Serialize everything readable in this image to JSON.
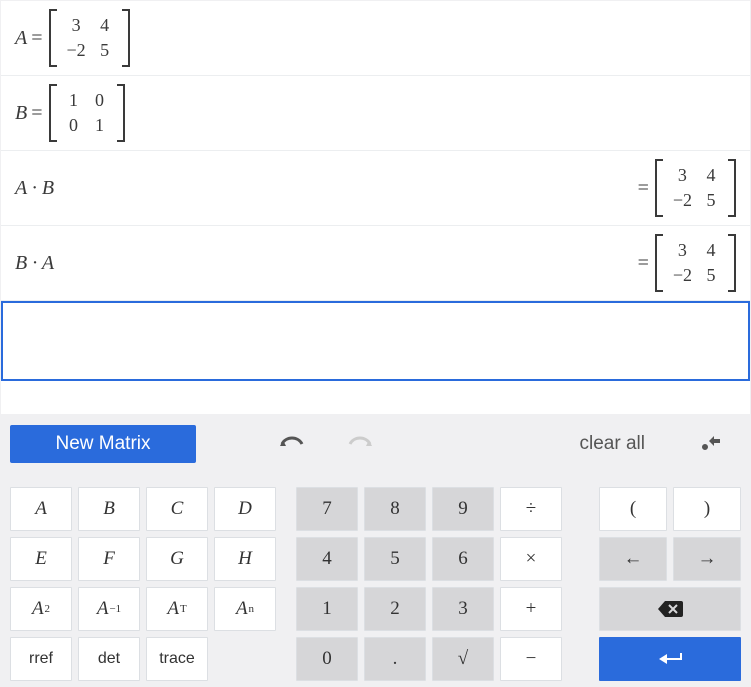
{
  "rows": {
    "r1_var": "A",
    "r1_eq": "=",
    "r2_var": "B",
    "r2_eq": "=",
    "r3_expr": "A · B",
    "r3_eq": "=",
    "r4_expr": "B · A",
    "r4_eq": "="
  },
  "matA": {
    "a": "3",
    "b": "4",
    "c": "−2",
    "d": "5"
  },
  "matB": {
    "a": "1",
    "b": "0",
    "c": "0",
    "d": "1"
  },
  "resAB": {
    "a": "3",
    "b": "4",
    "c": "−2",
    "d": "5"
  },
  "resBA": {
    "a": "3",
    "b": "4",
    "c": "−2",
    "d": "5"
  },
  "toolbar": {
    "new_matrix": "New Matrix",
    "clear_all": "clear all"
  },
  "keys": {
    "A": "A",
    "B": "B",
    "C": "C",
    "D": "D",
    "E": "E",
    "F": "F",
    "G": "G",
    "H": "H",
    "A2": "A",
    "Ainv": "A",
    "AT": "A",
    "An": "A",
    "A2_sup": "2",
    "Ainv_sup": "−1",
    "AT_sup": "T",
    "An_sup": "n",
    "rref": "rref",
    "det": "det",
    "trace": "trace",
    "n7": "7",
    "n8": "8",
    "n9": "9",
    "div": "÷",
    "n4": "4",
    "n5": "5",
    "n6": "6",
    "mul": "×",
    "n1": "1",
    "n2": "2",
    "n3": "3",
    "add": "+",
    "n0": "0",
    "dot": ".",
    "sqrt": "√",
    "sub": "−",
    "lp": "(",
    "rp": ")",
    "left": "←",
    "right": "→"
  }
}
